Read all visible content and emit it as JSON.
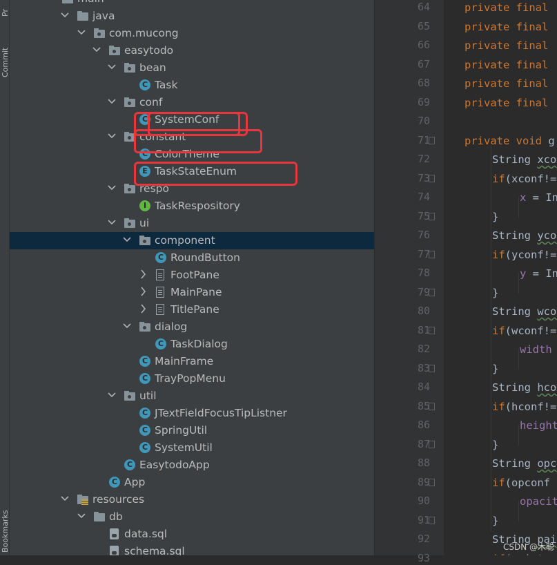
{
  "side_tabs": {
    "project": "Pr",
    "commit": "Commit",
    "bookmarks": "Bookmarks"
  },
  "tree": [
    {
      "label": "main",
      "kind": "folder",
      "expanded": true
    },
    {
      "label": "java",
      "kind": "folder",
      "expanded": true
    },
    {
      "label": "com.mucong",
      "kind": "package",
      "expanded": true
    },
    {
      "label": "easytodo",
      "kind": "package",
      "expanded": true
    },
    {
      "label": "bean",
      "kind": "package",
      "expanded": true
    },
    {
      "label": "Task",
      "kind": "class"
    },
    {
      "label": "conf",
      "kind": "package",
      "expanded": true
    },
    {
      "label": "SystemConf",
      "kind": "class"
    },
    {
      "label": "constant",
      "kind": "package",
      "expanded": true
    },
    {
      "label": "ColorTheme",
      "kind": "class"
    },
    {
      "label": "TaskStateEnum",
      "kind": "enum"
    },
    {
      "label": "respo",
      "kind": "package",
      "expanded": true
    },
    {
      "label": "TaskRespository",
      "kind": "interface"
    },
    {
      "label": "ui",
      "kind": "package",
      "expanded": true
    },
    {
      "label": "component",
      "kind": "package",
      "expanded": true
    },
    {
      "label": "RoundButton",
      "kind": "class"
    },
    {
      "label": "FootPane",
      "kind": "file",
      "expanded": false
    },
    {
      "label": "MainPane",
      "kind": "file",
      "expanded": false
    },
    {
      "label": "TitlePane",
      "kind": "file",
      "expanded": false
    },
    {
      "label": "dialog",
      "kind": "package",
      "expanded": true
    },
    {
      "label": "TaskDialog",
      "kind": "class"
    },
    {
      "label": "MainFrame",
      "kind": "class"
    },
    {
      "label": "TrayPopMenu",
      "kind": "class"
    },
    {
      "label": "util",
      "kind": "package",
      "expanded": true
    },
    {
      "label": "JTextFieldFocusTipListner",
      "kind": "class"
    },
    {
      "label": "SpringUtil",
      "kind": "class"
    },
    {
      "label": "SystemUtil",
      "kind": "class"
    },
    {
      "label": "EasytodoApp",
      "kind": "class"
    },
    {
      "label": "App",
      "kind": "app"
    },
    {
      "label": "resources",
      "kind": "resources",
      "expanded": true
    },
    {
      "label": "db",
      "kind": "folder",
      "expanded": true
    },
    {
      "label": "data.sql",
      "kind": "sql"
    },
    {
      "label": "schema.sql",
      "kind": "sql"
    }
  ],
  "icon_letters": {
    "class": "C",
    "enum": "E",
    "interface": "I",
    "app": "C"
  },
  "editor": {
    "line_numbers": [
      "64",
      "65",
      "66",
      "67",
      "68",
      "69",
      "70",
      "71",
      "72",
      "73",
      "74",
      "75",
      "76",
      "77",
      "78",
      "79",
      "80",
      "81",
      "82",
      "83",
      "84",
      "85",
      "86",
      "87",
      "88",
      "89",
      "90",
      "91",
      "92",
      "93"
    ],
    "lines": [
      "private final",
      "private final",
      "private final",
      "private final",
      "private final",
      "private final",
      "",
      "private void g",
      "String xco",
      "if(xconf!=",
      "x = In",
      "}",
      "String yco",
      "if(yconf!=",
      "y = In",
      "}",
      "String wco",
      "if(wconf!=",
      "width",
      "}",
      "String hco",
      "if(hconf!=",
      "height",
      "}",
      "String opc",
      "if(opconf",
      "opacit",
      "}",
      "String pai",
      "if(paintc"
    ]
  },
  "watermark": "CSDN @木聪",
  "colors": {
    "tree_bg": "#3c3f41",
    "editor_bg": "#2b2b2b",
    "selection": "#0d293e",
    "highlight": "#e8363c",
    "keyword": "#cc7832",
    "field": "#9876aa"
  }
}
